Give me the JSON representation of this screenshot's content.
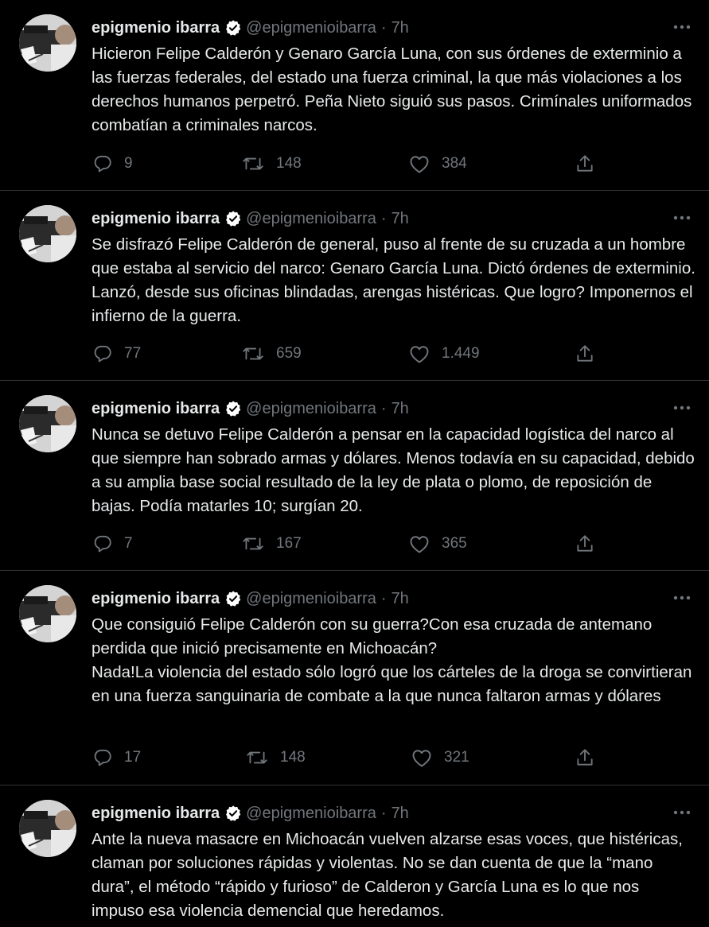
{
  "colors": {
    "background": "#000000",
    "text": "#e7e9ea",
    "secondary": "#71767b",
    "divider": "#2f3336",
    "verified": "#ffffff"
  },
  "icons": {
    "more": "more-icon",
    "verified": "verified-badge-icon",
    "reply": "reply-icon",
    "retweet": "retweet-icon",
    "like": "like-icon",
    "share": "share-icon"
  },
  "tweets": [
    {
      "name": "epigmenio ibarra",
      "handle": "@epigmenioibarra",
      "separator": "·",
      "time": "7h",
      "text": "Hicieron Felipe Calderón y Genaro García Luna, con sus órdenes de exterminio a las fuerzas federales, del estado una fuerza criminal, la que más violaciones a los derechos humanos perpetró. Peña Nieto siguió sus pasos. Crimínales uniformados combatían a criminales narcos.",
      "replies": "9",
      "retweets": "148",
      "likes": "384"
    },
    {
      "name": "epigmenio ibarra",
      "handle": "@epigmenioibarra",
      "separator": "·",
      "time": "7h",
      "text": "Se disfrazó Felipe Calderón de general, puso al frente de su cruzada a un hombre que estaba al servicio del narco: Genaro García Luna. Dictó órdenes de exterminio. Lanzó, desde sus oficinas blindadas, arengas histéricas. Que logro? Imponernos el infierno de la guerra.",
      "replies": "77",
      "retweets": "659",
      "likes": "1.449"
    },
    {
      "name": "epigmenio ibarra",
      "handle": "@epigmenioibarra",
      "separator": "·",
      "time": "7h",
      "text": "Nunca se detuvo Felipe Calderón a pensar en la capacidad logística del narco al que siempre han sobrado armas y dólares. Menos todavía en su capacidad, debido a su amplia base social resultado de la ley de plata o plomo, de reposición de bajas. Podía matarles 10; surgían 20.",
      "replies": "7",
      "retweets": "167",
      "likes": "365"
    },
    {
      "name": "epigmenio ibarra",
      "handle": "@epigmenioibarra",
      "separator": "·",
      "time": "7h",
      "text": "Que consiguió Felipe Calderón con su guerra?Con esa cruzada de antemano perdida que inició precisamente en Michoacán?\nNada!La violencia del estado sólo logró que los cárteles de la droga se convirtieran en una fuerza sanguinaria de combate a la que nunca faltaron armas y dólares",
      "replies": "17",
      "retweets": "148",
      "likes": "321"
    },
    {
      "name": "epigmenio ibarra",
      "handle": "@epigmenioibarra",
      "separator": "·",
      "time": "7h",
      "text": "Ante la nueva masacre en Michoacán vuelven alzarse esas voces, que histéricas, claman por soluciones rápidas y violentas. No se dan cuenta de que la “mano dura”, el método “rápido y furioso” de Calderon y García Luna es lo que nos impuso esa violencia demencial que heredamos."
    }
  ]
}
